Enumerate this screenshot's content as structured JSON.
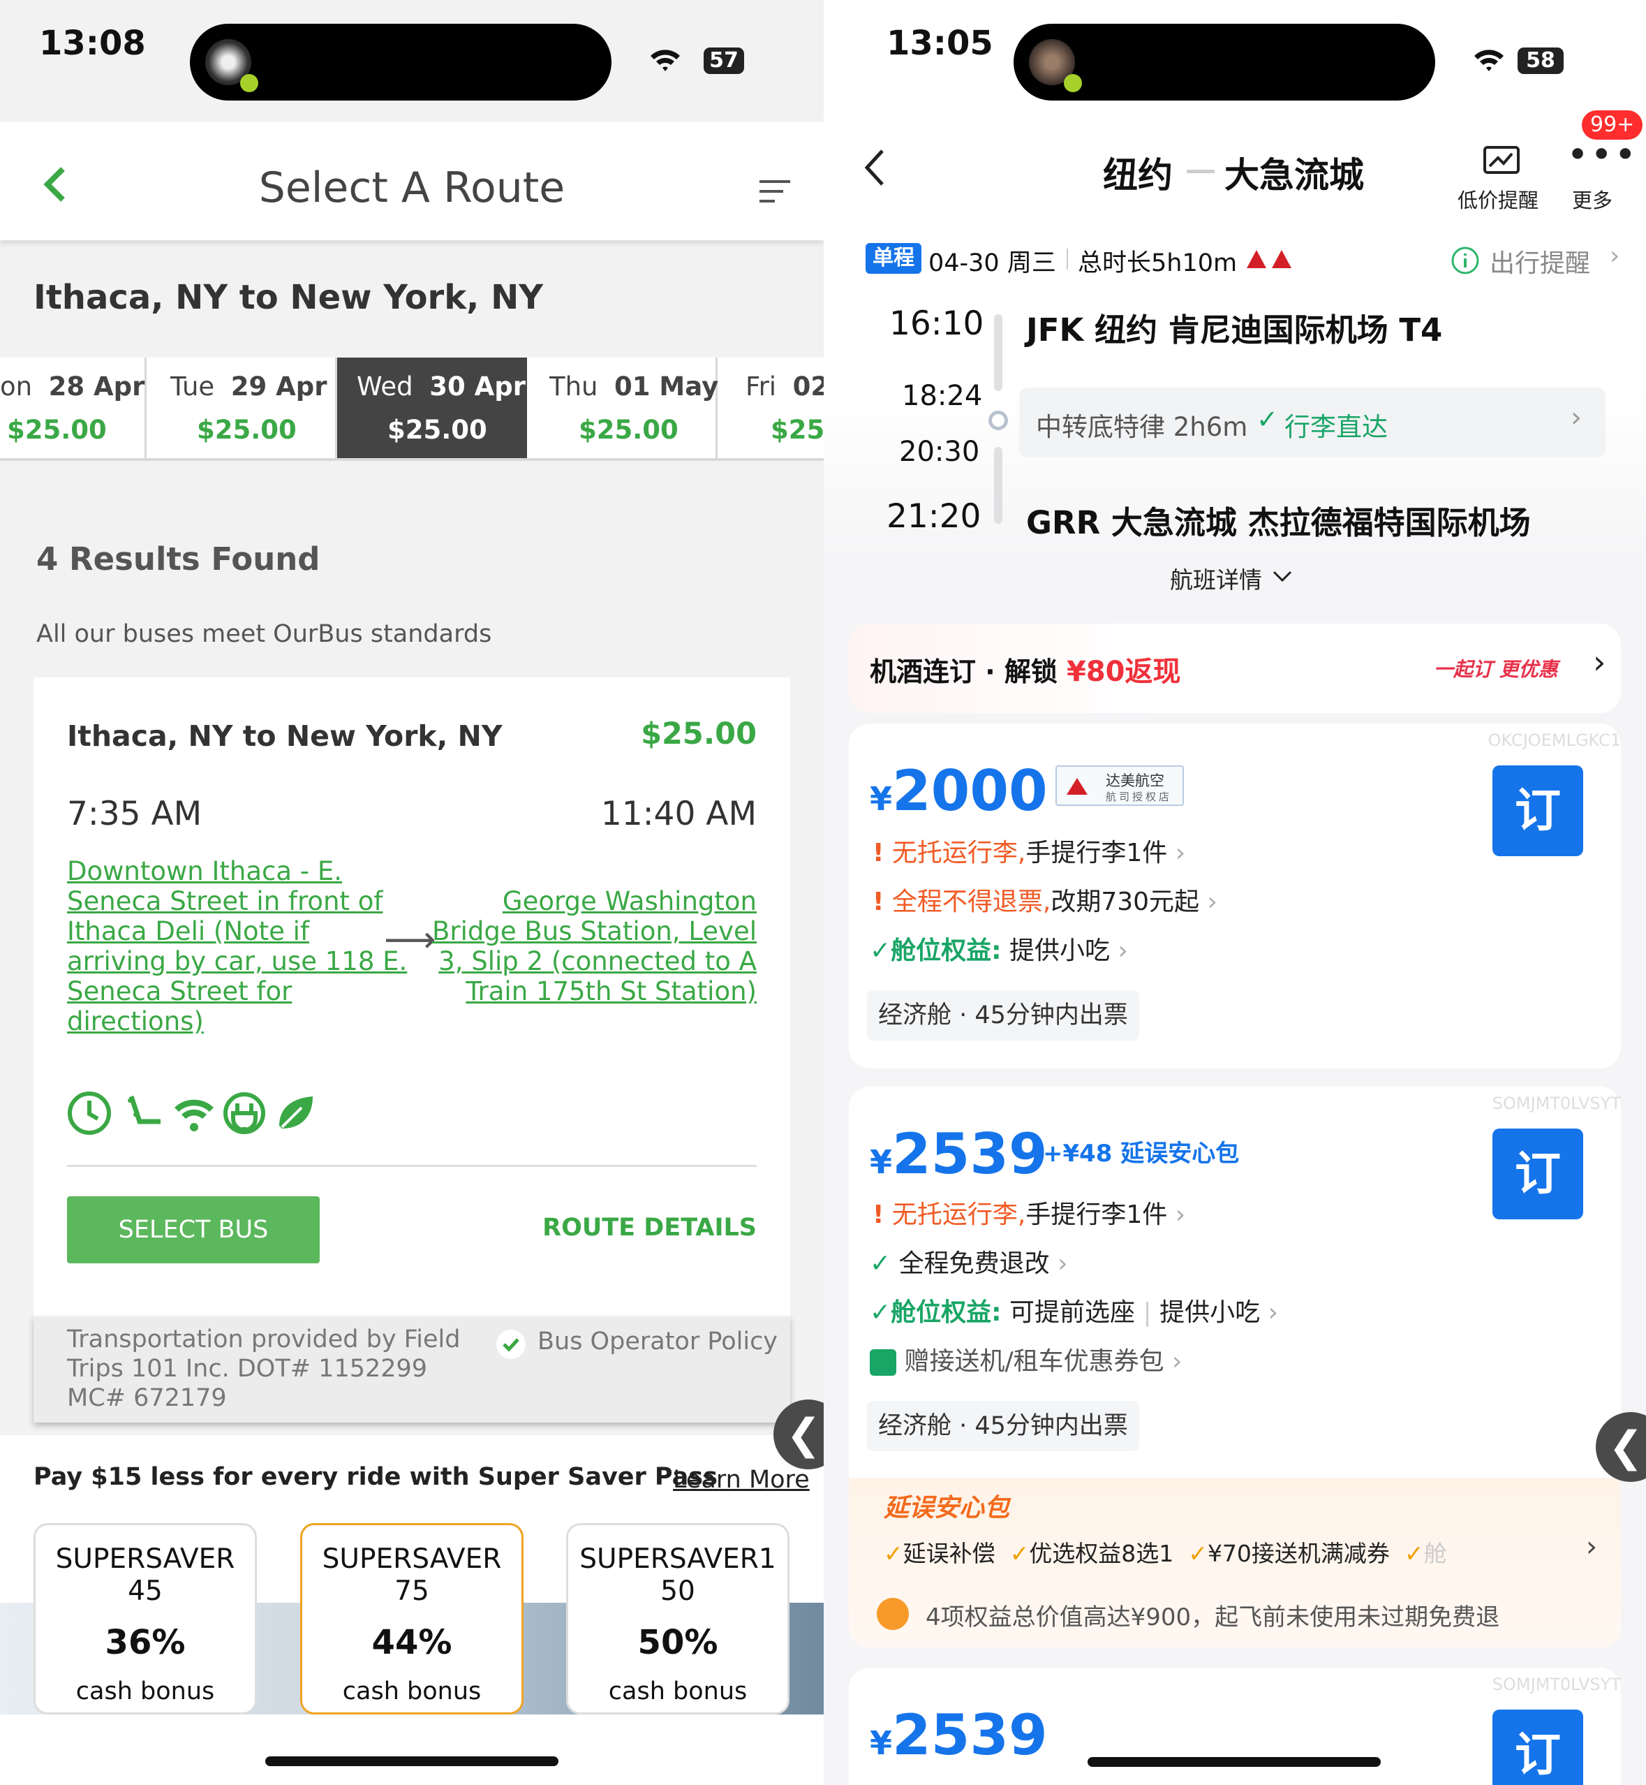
{
  "left": {
    "status": {
      "time": "13:08",
      "battery": "57"
    },
    "header": {
      "title": "Select A Route"
    },
    "route_heading": "Ithaca, NY to New York, NY",
    "dates": [
      {
        "day": "on",
        "date": "28 Apr",
        "price": "$25.00",
        "selected": false
      },
      {
        "day": "Tue",
        "date": "29 Apr",
        "price": "$25.00",
        "selected": false
      },
      {
        "day": "Wed",
        "date": "30 Apr",
        "price": "$25.00",
        "selected": true
      },
      {
        "day": "Thu",
        "date": "01 May",
        "price": "$25.00",
        "selected": false
      },
      {
        "day": "Fri",
        "date": "02",
        "price": "$25.",
        "selected": false
      }
    ],
    "results_count": "4 Results Found",
    "standards_note": "All our buses meet OurBus standards",
    "trip": {
      "route": "Ithaca, NY to New York, NY",
      "price": "$25.00",
      "depart_time": "7:35 AM",
      "arrive_time": "11:40 AM",
      "origin_lines": [
        "Downtown Ithaca - E.",
        "Seneca Street in front of",
        "Ithaca Deli   (Note if",
        "arriving by car, use 118 E.",
        "Seneca Street for",
        "directions)"
      ],
      "dest_lines": [
        "George Washington",
        "Bridge Bus Station, Level",
        "3, Slip 2 (connected to A",
        "Train 175th St Station)"
      ],
      "arrow": "⟶",
      "amenities": [
        "clock-icon",
        "legroom-icon",
        "wifi-icon",
        "power-outlet-icon",
        "eco-leaf-icon"
      ],
      "select_label": "SELECT BUS",
      "details_label": "ROUTE DETAILS",
      "operator_lines": [
        "Transportation provided by Field",
        "Trips 101 Inc.  DOT# 1152299",
        "MC# 672179"
      ],
      "policy_label": "Bus Operator Policy"
    },
    "pass_promo": {
      "text": "Pay $15 less for every ride with Super Saver Pass",
      "learn_more": "Learn More"
    },
    "passes": [
      {
        "name1": "SUPERSAVER",
        "name2": "45",
        "pct": "36%",
        "bonus": "cash bonus",
        "highlight": false
      },
      {
        "name1": "SUPERSAVER",
        "name2": "75",
        "pct": "44%",
        "bonus": "cash bonus",
        "highlight": true
      },
      {
        "name1": "SUPERSAVER1",
        "name2": "50",
        "pct": "50%",
        "bonus": "cash bonus",
        "highlight": false
      }
    ],
    "side_tab": "❮"
  },
  "right": {
    "status": {
      "time": "13:05",
      "battery": "58"
    },
    "badge": "99+",
    "header": {
      "from": "纽约",
      "to": "大急流城",
      "alert_label": "低价提醒",
      "more_label": "更多"
    },
    "trip_info": {
      "tag": "单程",
      "date": "04-30 周三",
      "duration": "总时长5h10m",
      "reminder": "出行提醒"
    },
    "itinerary": {
      "dep_time": "16:10",
      "dep_airport": "JFK  纽约 肯尼迪国际机场 T4",
      "layover_arr": "18:24",
      "layover_dep": "20:30",
      "layover_text": "中转底特律 2h6m",
      "baggage_through": "行李直达",
      "arr_time": "21:20",
      "arr_airport": "GRR  大急流城 杰拉德福特国际机场",
      "details_label": "航班详情"
    },
    "promo": {
      "text": "机酒连订 · 解锁",
      "amount": "¥80返现",
      "brand": "一起订 更优惠"
    },
    "offers": [
      {
        "code": "OKCJOEMLGKC1",
        "price": "2000",
        "airline_name": "达美航空",
        "airline_sub": "航司授权店",
        "line1_warn": "无托运行李,",
        "line1_rest": "手提行李1件",
        "line2_warn": "全程不得退票,",
        "line2_rest": "改期730元起",
        "line3_key": "舱位权益:",
        "line3_rest": "提供小吃",
        "cabin": "经济舱 · 45分钟内出票",
        "book": "订"
      },
      {
        "code": "SOMJMT0LVSYT",
        "price": "2539",
        "addon": "+¥48 延误安心包",
        "line1_warn": "无托运行李,",
        "line1_rest": "手提行李1件",
        "line2_ok": "全程免费退改",
        "line3_key": "舱位权益:",
        "line3_rest": "可提前选座",
        "line3_rest2": "提供小吃",
        "line4": "赠接送机/租车优惠券包",
        "cabin": "经济舱 · 45分钟内出票",
        "book": "订",
        "insurance": {
          "title": "延误安心包",
          "items": [
            "延误补偿",
            "优选权益8选1",
            "¥70接送机满减券",
            "舱"
          ],
          "note": "4项权益总价值高达¥900，起飞前未使用未过期免费退"
        }
      },
      {
        "code": "SOMJMT0LVSYT",
        "price": "2539",
        "book": "订"
      }
    ],
    "side_tab": "❮",
    "colors": {
      "accent": "#1574ea",
      "warn": "#f15a24",
      "ok": "#19a566"
    }
  }
}
